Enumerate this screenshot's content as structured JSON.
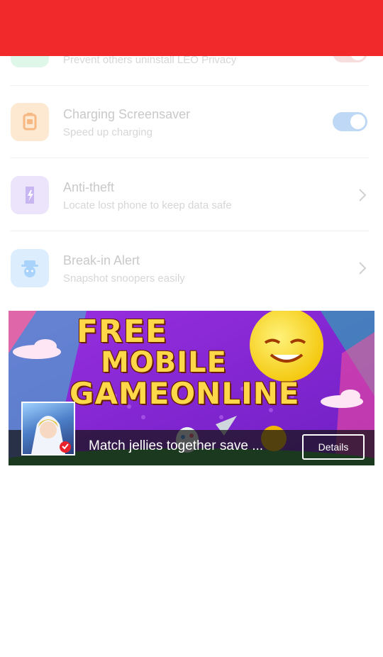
{
  "settings": {
    "items": [
      {
        "title": "",
        "subtitle": "Prevent others uninstall LEO Privacy",
        "icon": "shield-icon",
        "control": "toggle"
      },
      {
        "title": "Charging Screensaver",
        "subtitle": "Speed up charging",
        "icon": "charging-screensaver-icon",
        "control": "toggle",
        "toggle_on": true
      },
      {
        "title": "Anti-theft",
        "subtitle": "Locate lost phone to keep data safe",
        "icon": "anti-theft-icon",
        "control": "chevron"
      },
      {
        "title": "Break-in Alert",
        "subtitle": "Snapshot snoopers easily",
        "icon": "spy-icon",
        "control": "chevron"
      }
    ]
  },
  "ad": {
    "headline_line1": "FREE",
    "headline_line2": "MOBILE",
    "headline_line3": "GAMEONLINE",
    "description": "Match jellies together save ...",
    "cta_label": "Details"
  },
  "colors": {
    "header": "#f2292b",
    "toggle_track": "#bfd8f5",
    "text_title": "#c9c9c9",
    "text_subtitle": "#d6d6d6"
  }
}
